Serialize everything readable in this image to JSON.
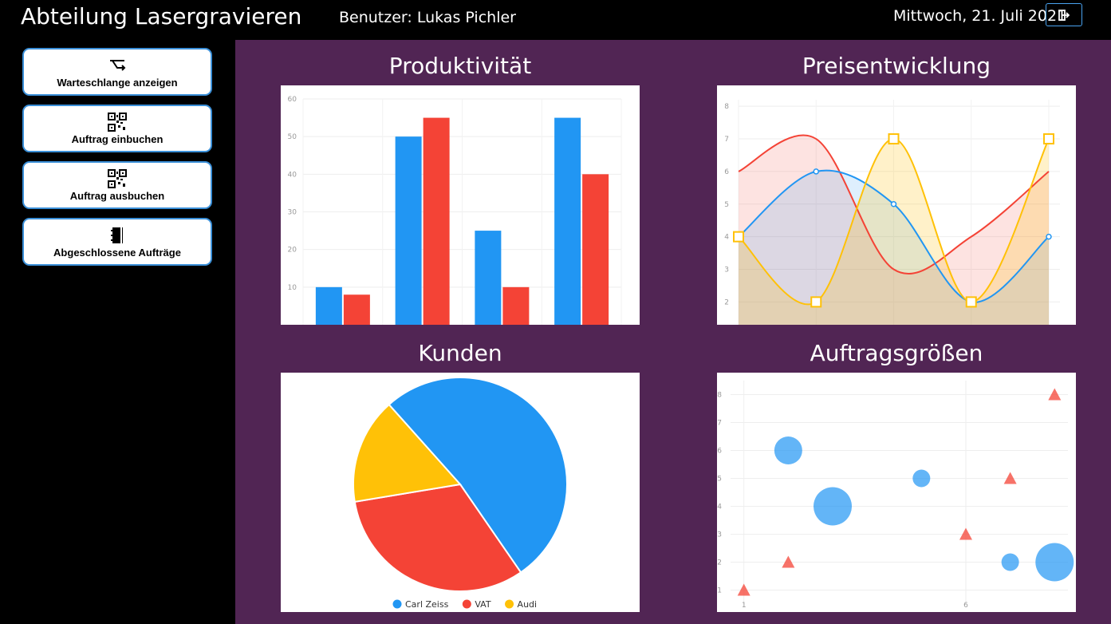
{
  "header": {
    "title": "Abteilung Lasergravieren",
    "user": "Benutzer: Lukas Pichler",
    "date": "Mittwoch, 21. Juli 2021",
    "logout_icon": "logout-icon"
  },
  "sidebar": {
    "items": [
      {
        "label": "Warteschlange anzeigen",
        "icon": "queue-icon"
      },
      {
        "label": "Auftrag einbuchen",
        "icon": "qr-code-icon"
      },
      {
        "label": "Auftrag ausbuchen",
        "icon": "qr-code-icon"
      },
      {
        "label": "Abgeschlossene Aufträge",
        "icon": "notebook-icon"
      }
    ]
  },
  "panels": {
    "productivity": {
      "title": "Produktivität"
    },
    "prices": {
      "title": "Preisentwicklung"
    },
    "customers": {
      "title": "Kunden"
    },
    "orders": {
      "title": "Auftragsgrößen"
    }
  },
  "colors": {
    "blue": "#2196f3",
    "red": "#f44336",
    "yellow": "#ffc107",
    "background": "#512554"
  },
  "chart_data": [
    {
      "type": "bar",
      "title": "Produktivität",
      "ylim": [
        0,
        60
      ],
      "yticks": [
        10,
        20,
        30,
        40,
        50,
        60
      ],
      "categories": [
        "",
        "",
        "",
        ""
      ],
      "series": [
        {
          "values": [
            10,
            50,
            25,
            55
          ],
          "color": "#2196f3"
        },
        {
          "values": [
            8,
            55,
            10,
            40
          ],
          "color": "#f44336"
        }
      ]
    },
    {
      "type": "area",
      "title": "Preisentwicklung",
      "ylim": [
        1.3,
        8.2
      ],
      "yticks": [
        2,
        3,
        4,
        5,
        6,
        7,
        8
      ],
      "x": [
        1,
        2,
        3,
        4,
        5
      ],
      "series": [
        {
          "values": [
            6,
            7,
            3,
            4,
            6
          ],
          "color": "#f44336",
          "marker": "none"
        },
        {
          "values": [
            4,
            6,
            5,
            2,
            4
          ],
          "color": "#2196f3",
          "marker": "circle"
        },
        {
          "values": [
            4,
            2,
            7,
            2,
            7
          ],
          "color": "#ffc107",
          "marker": "square"
        }
      ]
    },
    {
      "type": "pie",
      "title": "Kunden",
      "slices": [
        {
          "label": "Carl Zeiss",
          "value": 52,
          "color": "#2196f3"
        },
        {
          "label": "VAT",
          "value": 32,
          "color": "#f44336"
        },
        {
          "label": "Audi",
          "value": 16,
          "color": "#ffc107"
        }
      ],
      "legend": "bottom"
    },
    {
      "type": "scatter",
      "title": "Auftragsgrößen",
      "xlim": [
        0.7,
        8.3
      ],
      "ylim": [
        0.5,
        8.5
      ],
      "xticks": [
        1,
        6
      ],
      "yticks": [
        1,
        2,
        3,
        4,
        5,
        6,
        7,
        8
      ],
      "series": [
        {
          "color": "#2196f3",
          "marker": "circle",
          "points": [
            [
              2,
              6,
              3
            ],
            [
              3,
              4,
              4
            ],
            [
              5,
              5,
              2
            ],
            [
              7,
              2,
              2
            ],
            [
              8,
              2,
              4
            ]
          ]
        },
        {
          "color": "#f44336",
          "marker": "triangle",
          "points": [
            [
              1,
              1
            ],
            [
              2,
              2
            ],
            [
              6,
              3
            ],
            [
              7,
              5
            ],
            [
              8,
              8
            ]
          ]
        }
      ]
    }
  ]
}
